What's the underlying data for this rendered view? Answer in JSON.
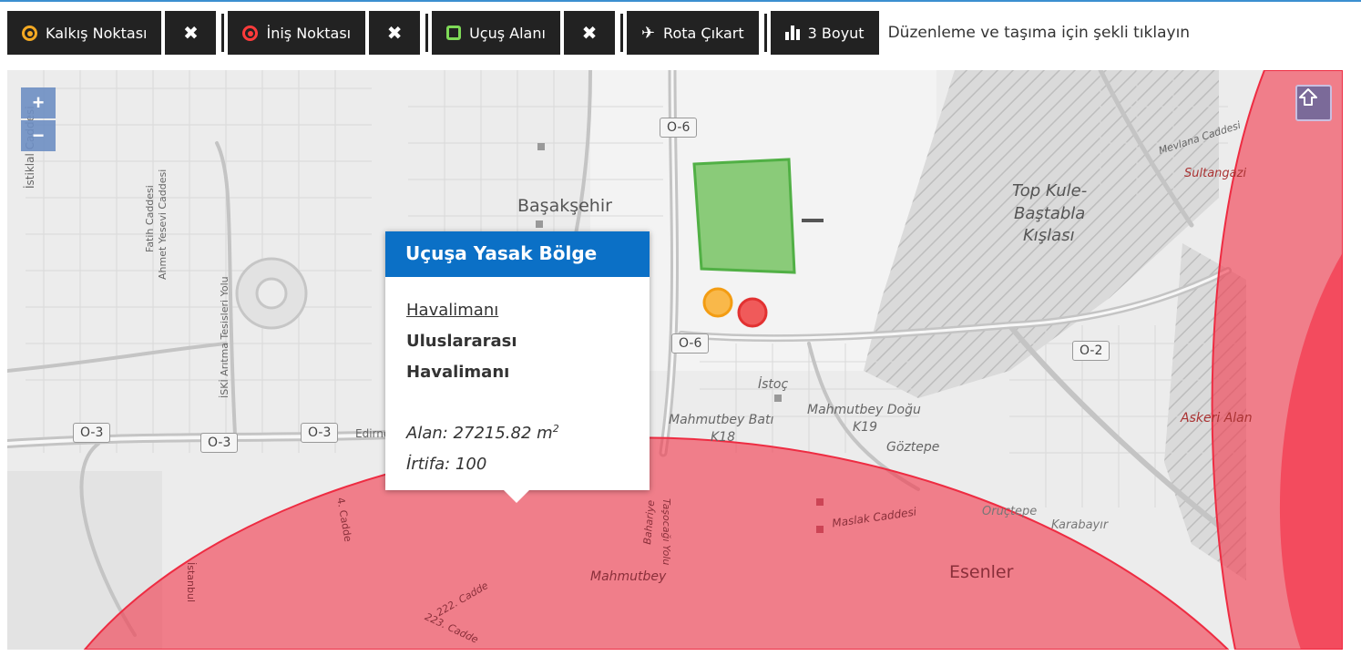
{
  "toolbar": {
    "takeoff_label": "Kalkış Noktası",
    "landing_label": "İniş Noktası",
    "area_label": "Uçuş Alanı",
    "route_label": "Rota Çıkart",
    "view3d_label": "3 Boyut",
    "clear_symbol": "✖",
    "hint": "Düzenleme ve taşıma için şekli tıklayın"
  },
  "colors": {
    "toolbar_bg": "#222222",
    "takeoff": "#f4a923",
    "landing": "#ff3b3b",
    "area": "#7ed957",
    "no_fly_zone": "#f23a4e",
    "popup_header": "#0b70c6"
  },
  "map": {
    "zoom_in": "+",
    "zoom_out": "−",
    "labels": {
      "basaksehir": "Başakşehir",
      "top_kule_1": "Top Kule-",
      "top_kule_2": "Baştabla",
      "top_kule_3": "Kışlası",
      "sultangazi": "Sultangazi",
      "mevlana": "Mevlana Caddesi",
      "istoc": "İstoç",
      "mahmutbey_bati": "Mahmutbey Batı",
      "k18": "K18",
      "mahmutbey_dogu": "Mahmutbey Doğu",
      "k19": "K19",
      "goztepe": "Göztepe",
      "oructepe": "Oruçtepe",
      "karabayir": "Karabayır",
      "askeri_alan": "Askeri Alan",
      "esenler": "Esenler",
      "mahmutbey": "Mahmutbey",
      "maslak": "Maslak Caddesi",
      "istiklal": "İstiklal Caddesi",
      "fatih": "Fatih Caddesi",
      "ahmet": "Ahmet Yesevi Caddesi",
      "iski": "İSKİ Arıtma Tesisleri Yolu",
      "edirne": "Edirne",
      "cadde4": "4. Cadde",
      "cadde222": "222. Cadde",
      "cadde223": "223. Cadde",
      "istanbul": "İstanbul",
      "bahariye": "Bahariye",
      "tasocagi": "Taşocağı Yolu"
    },
    "shields": {
      "o6_top": "O-6",
      "o6_mid": "O-6",
      "o2": "O-2",
      "o3_a": "O-3",
      "o3_b": "O-3",
      "o3_c": "O-3"
    }
  },
  "popup": {
    "title": "Uçuşa Yasak Bölge",
    "category": "Havalimanı",
    "name_line1": "Uluslararası",
    "name_line2": "Havalimanı",
    "area_text": "Alan: 27215.82 m",
    "area_unit_sup": "2",
    "altitude_text": "İrtifa: 100"
  }
}
